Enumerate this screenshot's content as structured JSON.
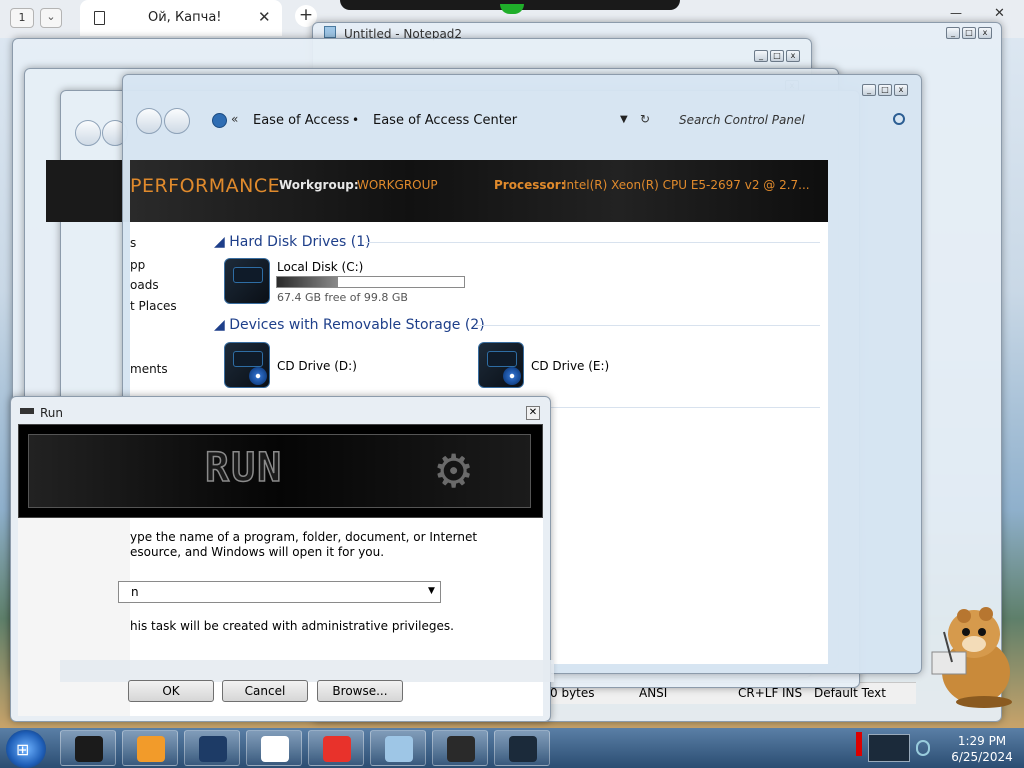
{
  "browser": {
    "tab_counter": "1",
    "tab_chevron": "⌄",
    "tab_title": "Ой, Капча!",
    "tab_close": "✕",
    "new_tab": "+",
    "minimize": "—",
    "close": "✕"
  },
  "notepad": {
    "title": "Untitled - Notepad2",
    "status": {
      "size": "0 bytes",
      "encoding": "ANSI",
      "eol": "CR+LF",
      "mode": "INS",
      "scheme": "Default Text"
    }
  },
  "explorer": {
    "breadcrumb_chevron": "«",
    "breadcrumb": [
      "Ease of Access",
      "Ease of Access Center"
    ],
    "breadcrumb_sep": "•",
    "dropdown_arrow": "▼",
    "refresh": "↻",
    "search_placeholder": "Search Control Panel",
    "banner": {
      "edition": "PERFORMANCE",
      "workgroup_label": "Workgroup:",
      "workgroup_value": "WORKGROUP",
      "processor_label": "Processor:",
      "processor_value": "Intel(R) Xeon(R) CPU E5-2697 v2 @ 2.7..."
    },
    "nav_items": [
      "s",
      "pp",
      "oads",
      "t Places",
      "ments"
    ],
    "groups": {
      "hdd_title": "Hard Disk Drives (1)",
      "removable_title": "Devices with Removable Storage (2)"
    },
    "drives": {
      "c_name": "Local Disk (C:)",
      "c_free": "67.4 GB free of 99.8 GB",
      "c_used_fraction": 0.325,
      "d_name": "CD Drive (D:)",
      "e_name": "CD Drive (E:)"
    }
  },
  "run": {
    "title": "Run",
    "close": "✕",
    "logo": "RUN",
    "desc_line1": "ype the name of a program, folder, document, or Internet",
    "desc_line2": "esource, and Windows will open it for you.",
    "combo_value": "n",
    "combo_arrow": "▼",
    "admin_note": "his task will be created with administrative privileges.",
    "buttons": {
      "ok": "OK",
      "cancel": "Cancel",
      "browse": "Browse..."
    }
  },
  "taskbar": {
    "time": "1:29 PM",
    "date": "6/25/2024",
    "tray_arrow": "▲",
    "items": [
      {
        "name": "taskbar-item-explorer",
        "color": "#1b1b1b"
      },
      {
        "name": "taskbar-item-media",
        "color": "#f29b2a"
      },
      {
        "name": "taskbar-item-globe",
        "color": "#1d3b66"
      },
      {
        "name": "taskbar-item-yandex-browser",
        "color": "#ffffff"
      },
      {
        "name": "taskbar-item-yandex",
        "color": "#e8322b"
      },
      {
        "name": "taskbar-item-notepad2",
        "color": "#9ec6e6"
      },
      {
        "name": "taskbar-item-run",
        "color": "#2a2a2a"
      },
      {
        "name": "taskbar-item-computer",
        "color": "#1b2a3a"
      }
    ]
  },
  "colors": {
    "accent_orange": "#e08a2c",
    "group_blue": "#1e3f8a",
    "taskbar": "#2b4d72"
  }
}
